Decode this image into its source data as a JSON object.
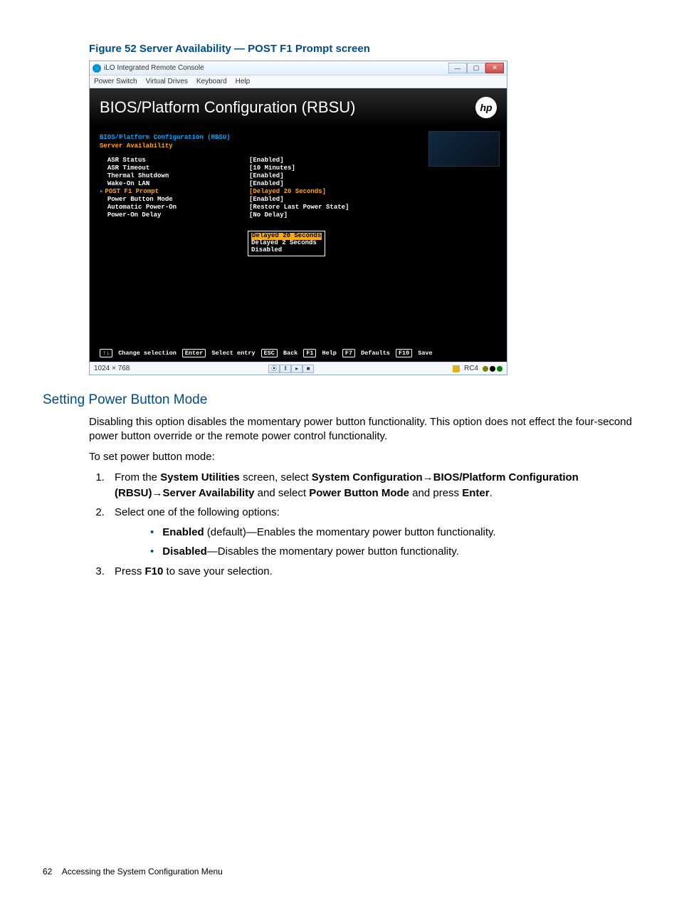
{
  "figure_caption": "Figure 52 Server Availability — POST F1 Prompt screen",
  "window": {
    "title": "iLO Integrated Remote Console",
    "menu": [
      "Power Switch",
      "Virtual Drives",
      "Keyboard",
      "Help"
    ]
  },
  "bios": {
    "header": "BIOS/Platform Configuration (RBSU)",
    "breadcrumb": "BIOS/Platform Configuration (RBSU)",
    "subcrumb": "Server Availability",
    "settings": [
      {
        "label": "ASR Status",
        "value": "[Enabled]",
        "selected": false
      },
      {
        "label": "ASR Timeout",
        "value": "[10 Minutes]",
        "selected": false
      },
      {
        "label": "Thermal Shutdown",
        "value": "[Enabled]",
        "selected": false
      },
      {
        "label": "Wake-On LAN",
        "value": "[Enabled]",
        "selected": false
      },
      {
        "label": "POST F1 Prompt",
        "value": "[Delayed 20 Seconds]",
        "selected": true
      },
      {
        "label": "Power Button Mode",
        "value": "[Enabled]",
        "selected": false
      },
      {
        "label": "Automatic Power-On",
        "value": "[Restore Last Power State]",
        "selected": false
      },
      {
        "label": "Power-On Delay",
        "value": "[No Delay]",
        "selected": false
      }
    ],
    "popup": [
      "Delayed 20 Seconds",
      "Delayed 2 Seconds",
      "Disabled"
    ],
    "hints": [
      {
        "key": "↑↓",
        "label": "Change selection"
      },
      {
        "key": "Enter",
        "label": "Select entry"
      },
      {
        "key": "ESC",
        "label": "Back"
      },
      {
        "key": "F1",
        "label": "Help"
      },
      {
        "key": "F7",
        "label": "Defaults"
      },
      {
        "key": "F10",
        "label": "Save"
      }
    ]
  },
  "statusbar": {
    "resolution": "1024 × 768",
    "rc": "RC4"
  },
  "section_heading": "Setting Power Button Mode",
  "para1": "Disabling this option disables the momentary power button functionality. This option does not effect the four-second power button override or the remote power control functionality.",
  "para2": "To set power button mode:",
  "step1_pre": "From the ",
  "step1_b1": "System Utilities",
  "step1_mid1": " screen, select ",
  "step1_b2": "System Configuration",
  "step1_arrow": "→",
  "step1_b3": "BIOS/Platform Configuration (RBSU)",
  "step1_b4": "Server Availability",
  "step1_mid2": " and select ",
  "step1_b5": "Power Button Mode",
  "step1_mid3": " and press ",
  "step1_b6": "Enter",
  "step2": "Select one of the following options:",
  "opt1_b": "Enabled",
  "opt1_rest": " (default)—Enables the momentary power button functionality.",
  "opt2_b": "Disabled",
  "opt2_rest": "—Disables the momentary power button functionality.",
  "step3_pre": "Press ",
  "step3_b": "F10",
  "step3_post": " to save your selection.",
  "footer_page": "62",
  "footer_text": "Accessing the System Configuration Menu"
}
